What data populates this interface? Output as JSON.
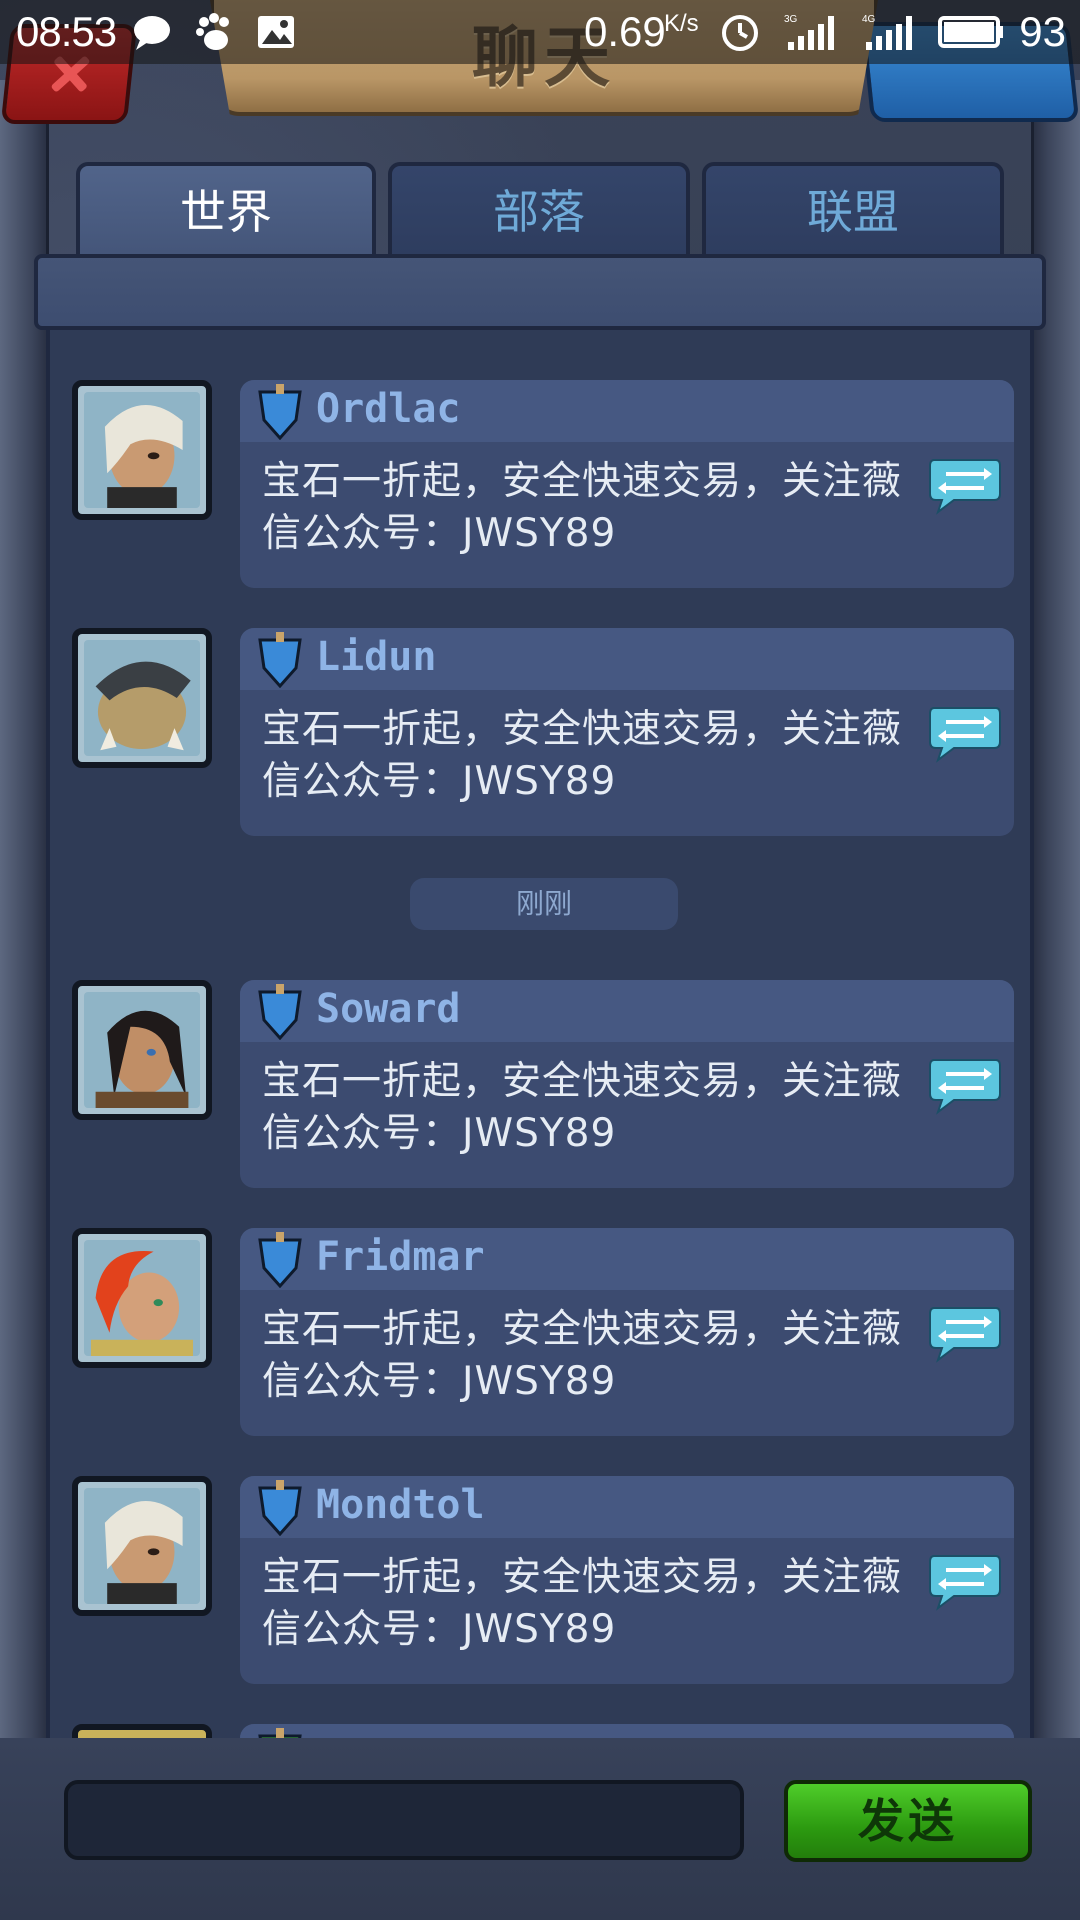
{
  "status_bar": {
    "time": "08:53",
    "net_speed": "0.69",
    "net_speed_unit": "K/s",
    "network_1": "3G",
    "network_2": "4G",
    "battery": "93",
    "icons": [
      "chat-bubble-icon",
      "baidu-paw-icon",
      "gallery-icon",
      "alarm-icon",
      "signal-icon",
      "battery-icon"
    ]
  },
  "header": {
    "title": "聊天",
    "close_icon": "close-icon",
    "info_icon": "info-icon"
  },
  "tabs": [
    {
      "label": "世界",
      "active": true
    },
    {
      "label": "部落",
      "active": false
    },
    {
      "label": "联盟",
      "active": false
    }
  ],
  "messages": [
    {
      "username": "Ordlac",
      "text": "宝石一折起，安全快速交易，关注薇信公众号：JWSY89",
      "avatar": "white-haired-woman-avatar"
    },
    {
      "username": "Lidun",
      "text": "宝石一折起，安全快速交易，关注薇信公众号：JWSY89",
      "avatar": "armored-beast-avatar"
    },
    {
      "username": "Soward",
      "text": "宝石一折起，安全快速交易，关注薇信公众号：JWSY89",
      "avatar": "dark-haired-warrior-avatar"
    },
    {
      "username": "Fridmar",
      "text": "宝石一折起，安全快速交易，关注薇信公众号：JWSY89",
      "avatar": "red-haired-woman-avatar"
    },
    {
      "username": "Mondtol",
      "text": "宝石一折起，安全快速交易，关注薇信公众号：JWSY89",
      "avatar": "white-haired-woman-avatar"
    }
  ],
  "time_separator": "刚刚",
  "input": {
    "value": "",
    "send_label": "发送"
  },
  "colors": {
    "accent_green": "#2c9a10",
    "username_blue": "#8fb4e6",
    "tab_inactive_text": "#6faad8"
  }
}
